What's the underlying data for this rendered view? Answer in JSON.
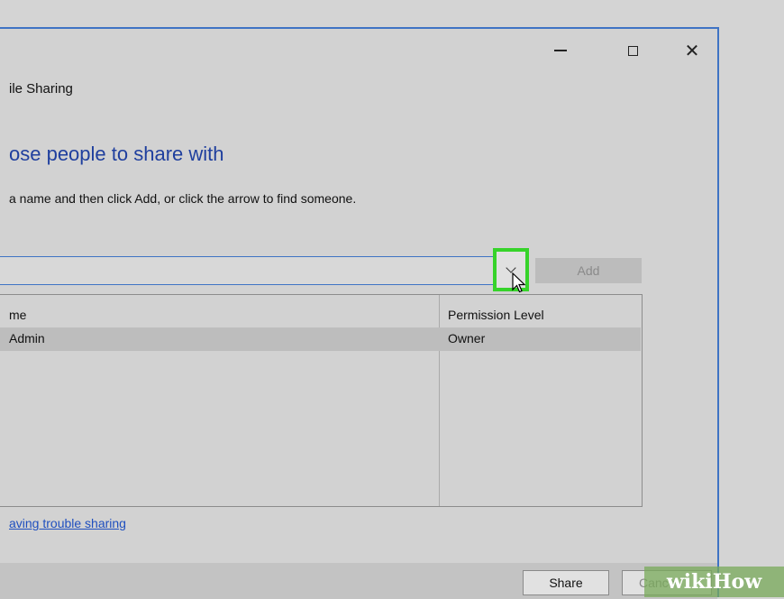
{
  "window": {
    "title": "ile Sharing",
    "minimize_icon": "minimize-icon",
    "maximize_icon": "maximize-icon",
    "close_icon": "close-icon",
    "close_glyph": "✕"
  },
  "heading": "ose people to share with",
  "instruction": "a name and then click Add, or click the arrow to find someone.",
  "search": {
    "value": "",
    "placeholder": ""
  },
  "add_label": "Add",
  "table": {
    "headers": [
      "me",
      "Permission Level"
    ],
    "rows": [
      {
        "name": "Admin",
        "permission": "Owner"
      }
    ]
  },
  "help_link": "aving trouble sharing",
  "footer": {
    "share_label": "Share",
    "cancel_label": "Cance"
  },
  "watermark": "wikiHow",
  "colors": {
    "accent": "#3f73c4",
    "heading": "#1f3f9e",
    "highlight": "#36d32a",
    "link": "#1f4fbf"
  }
}
